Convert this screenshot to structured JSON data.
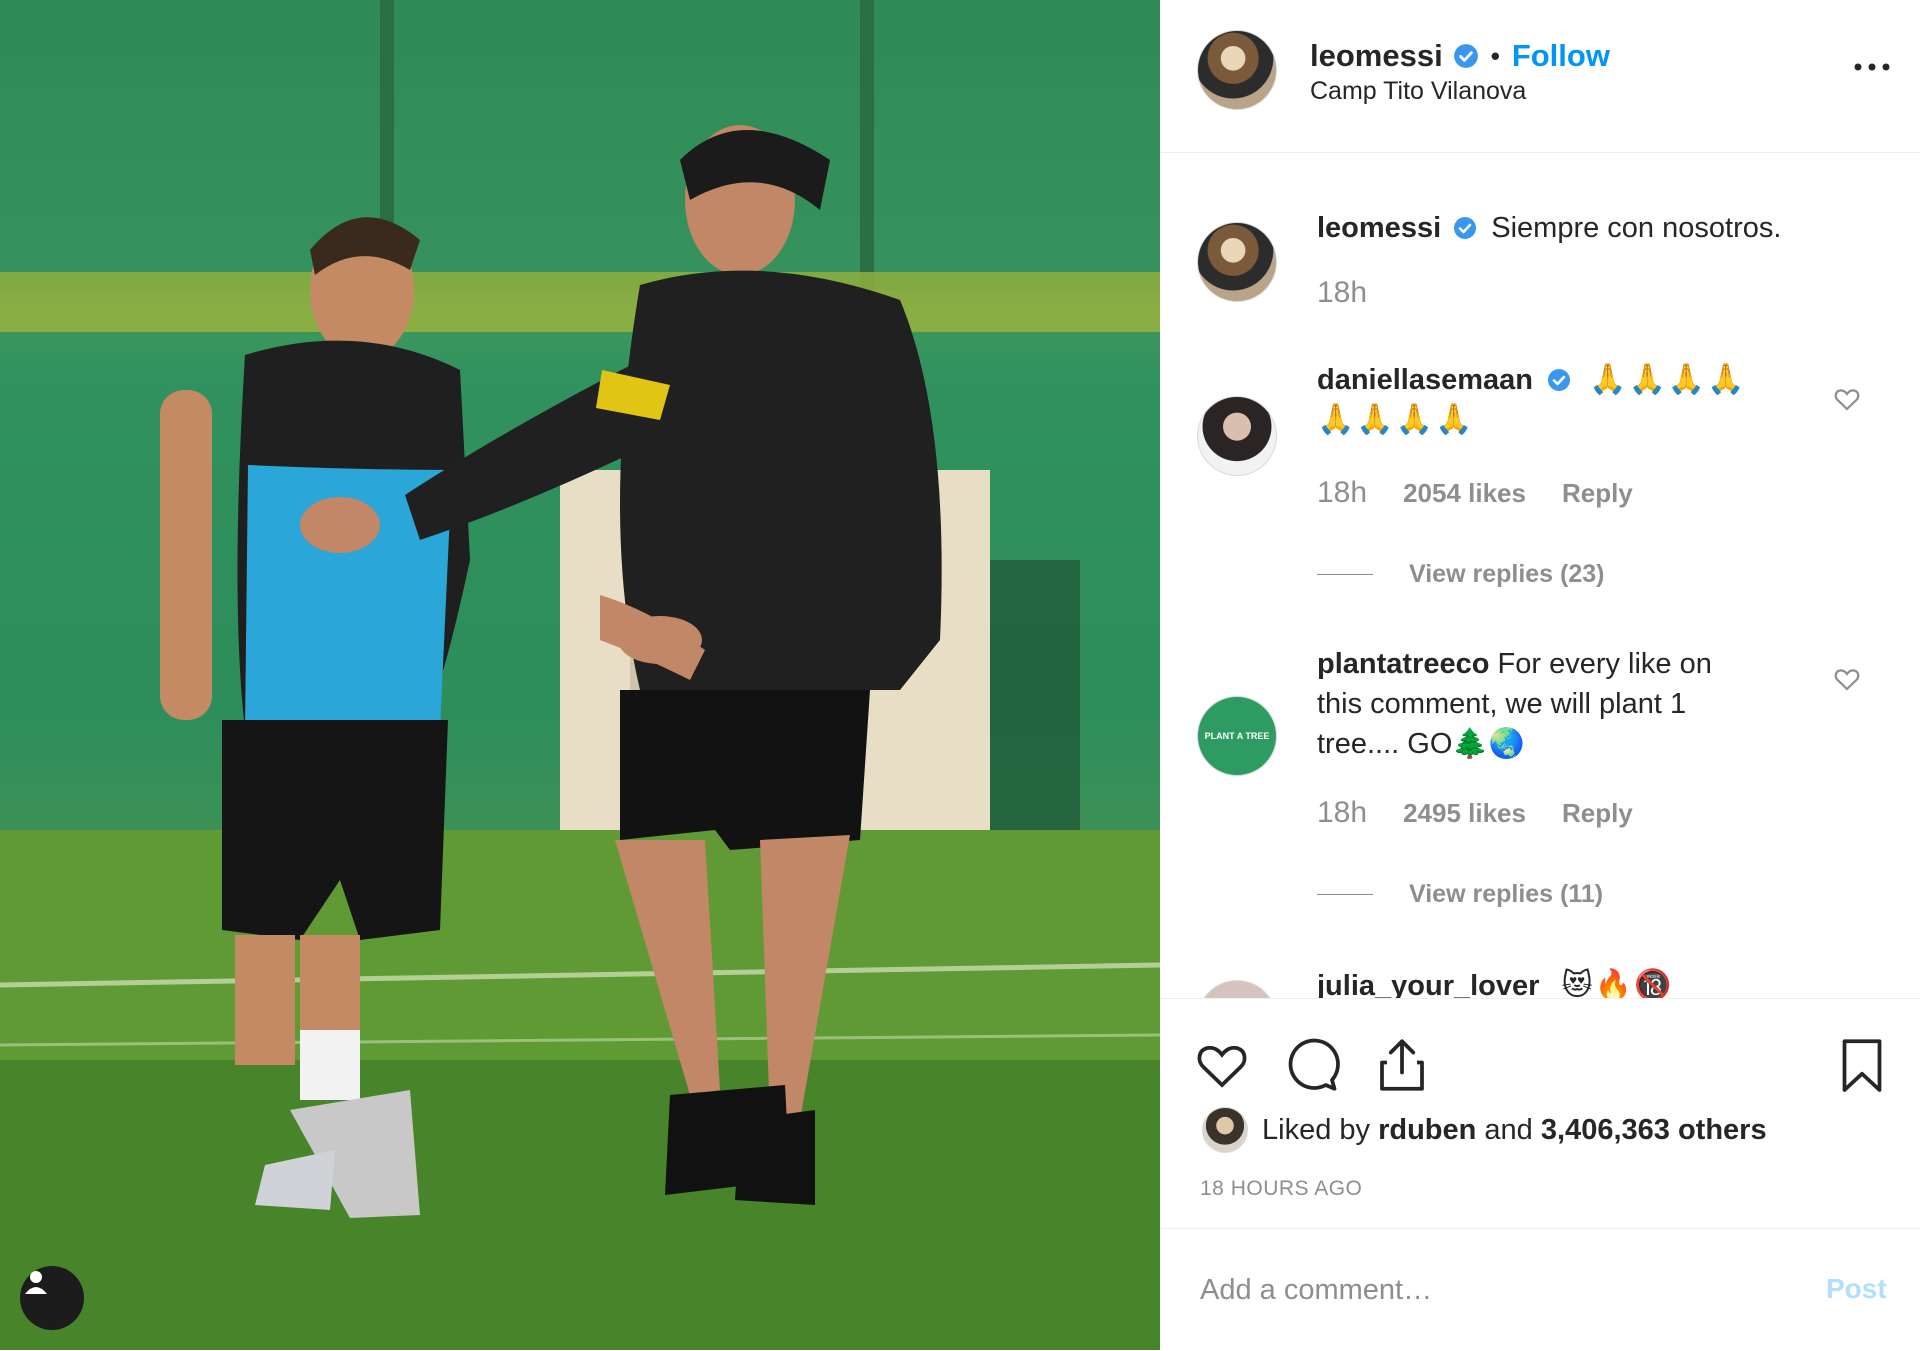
{
  "post": {
    "username": "leomessi",
    "follow_label": "Follow",
    "location": "Camp Tito Vilanova"
  },
  "caption": {
    "username": "leomessi",
    "text": "Siempre con nosotros.",
    "time": "18h"
  },
  "comments": [
    {
      "username": "daniellasemaan",
      "line1": "🙏🙏🙏🙏",
      "line2": "🙏🙏🙏🙏",
      "time": "18h",
      "likes": "2054 likes",
      "reply": "Reply",
      "view_replies": "View replies (23)"
    },
    {
      "username": "plantatreeco",
      "text": "For every like on this comment, we will plant 1 tree.... GO🌲🌏",
      "avatar_text": "PLANT A TREE",
      "time": "18h",
      "likes": "2495 likes",
      "reply": "Reply",
      "view_replies": "View replies (11)"
    },
    {
      "username": "julia_your_lover",
      "text": "😻🔥🔞"
    }
  ],
  "actions": {
    "liked_prefix": "Liked by",
    "liked_user": "rduben",
    "liked_mid": "and",
    "liked_count": "3,406,363 others",
    "time_ago": "18 HOURS AGO"
  },
  "add_comment": {
    "placeholder": "Add a comment…",
    "post_label": "Post"
  },
  "icons": {
    "verified": "verified-badge-icon",
    "more": "more-options-icon",
    "heart": "heart-icon",
    "comment": "comment-icon",
    "share": "share-icon",
    "save": "bookmark-icon",
    "user_tag": "user-tag-icon"
  },
  "colors": {
    "link": "#0095f6",
    "verified": "#3897f0",
    "muted": "#8e8e8e",
    "post_disabled": "#b2dffc"
  }
}
